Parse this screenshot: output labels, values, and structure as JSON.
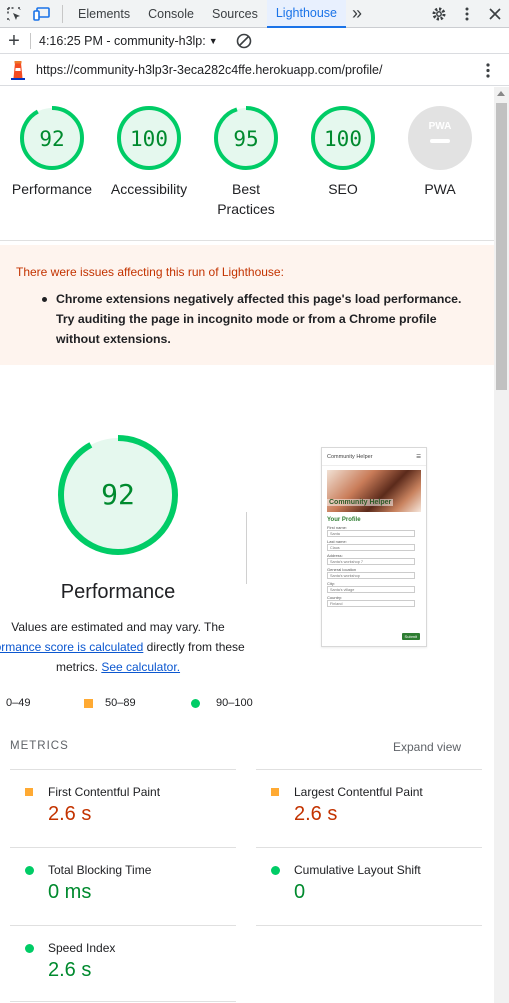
{
  "devtools": {
    "tabs": [
      "Elements",
      "Console",
      "Sources",
      "Lighthouse"
    ],
    "active_tab": "Lighthouse",
    "more_tabs": "»",
    "session": "4:16:25 PM - community-h3lp:",
    "url": "https://community-h3lp3r-3eca282c4ffe.herokuapp.com/profile/",
    "accent": "#1a73e8"
  },
  "gauges": [
    {
      "label": "Performance",
      "score": "92"
    },
    {
      "label": "Accessibility",
      "score": "100"
    },
    {
      "label": "Best Practices",
      "score": "95"
    },
    {
      "label": "SEO",
      "score": "100"
    },
    {
      "label": "PWA",
      "badge": "PWA"
    }
  ],
  "warning": {
    "title": "There were issues affecting this run of Lighthouse:",
    "item": "Chrome extensions negatively affected this page's load performance. Try auditing the page in incognito mode or from a Chrome profile without extensions."
  },
  "performance": {
    "score": "92",
    "title": "Performance",
    "desc_start": "Values are estimated and may vary. The",
    "link1": "formance score is calculated",
    "desc_mid": " directly from these metrics.",
    "link2": "See calculator."
  },
  "screenshot": {
    "brand": "Community Helper",
    "hero_text": "Community Helper",
    "heading": "Your Profile",
    "fields": [
      {
        "label": "First name:",
        "value": "Santa"
      },
      {
        "label": "Last name:",
        "value": "Claus"
      },
      {
        "label": "Address:",
        "value": "Santa's workshop 7"
      },
      {
        "label": "General location",
        "value": "Santa's workshop"
      },
      {
        "label": "City:",
        "value": "Santa's village"
      },
      {
        "label": "Country:",
        "value": "Finland"
      }
    ],
    "submit": "Submit"
  },
  "legend": {
    "fail": "0–49",
    "average": "50–89",
    "pass": "90–100"
  },
  "metrics": {
    "heading": "METRICS",
    "expand": "Expand view",
    "items": [
      {
        "name": "First Contentful Paint",
        "value": "2.6 s",
        "status": "average"
      },
      {
        "name": "Largest Contentful Paint",
        "value": "2.6 s",
        "status": "average"
      },
      {
        "name": "Total Blocking Time",
        "value": "0 ms",
        "status": "pass"
      },
      {
        "name": "Cumulative Layout Shift",
        "value": "0",
        "status": "pass"
      },
      {
        "name": "Speed Index",
        "value": "2.6 s",
        "status": "pass"
      }
    ]
  },
  "colors": {
    "pass": "#0c6",
    "average": "#fa3",
    "fail": "#e53935",
    "pass_text": "#008a2e",
    "average_text": "#c33300"
  }
}
